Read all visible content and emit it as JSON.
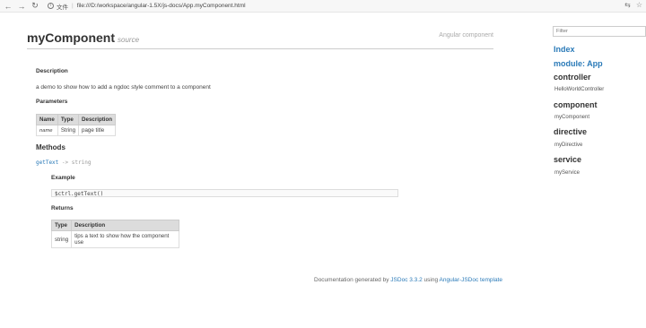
{
  "browser": {
    "back_icon": "←",
    "forward_icon": "→",
    "reload_icon": "↻",
    "info_icon": "i",
    "protocol_label": "文件",
    "separator": "|",
    "url": "file:///D:/workspace/angular-1.5X/js-docs/App.myComponent.html",
    "translate_icon": "⇆",
    "star_icon": "☆"
  },
  "header": {
    "title": "myComponent",
    "source_link": "source",
    "kind": "Angular component"
  },
  "description": {
    "heading": "Description",
    "text": "a demo to show how to add a ngdoc style comment to a component"
  },
  "parameters": {
    "heading": "Parameters",
    "columns": [
      "Name",
      "Type",
      "Description"
    ],
    "rows": [
      {
        "name": "name",
        "type": "String",
        "description": "page title"
      }
    ]
  },
  "methods": {
    "heading": "Methods",
    "items": [
      {
        "name": "getText",
        "arrow": "->",
        "returns_type": "string",
        "example_heading": "Example",
        "example_code": "$ctrl.getText()",
        "returns_heading": "Returns",
        "returns_columns": [
          "Type",
          "Description"
        ],
        "returns_rows": [
          {
            "type": "string",
            "description": "tips a text to show how the component use"
          }
        ]
      }
    ]
  },
  "footer": {
    "prefix": "Documentation generated by",
    "jsdoc_link": "JSDoc 3.3.2",
    "middle": "using",
    "template_link": "Angular-JSDoc template"
  },
  "sidebar": {
    "filter_placeholder": "Filter",
    "index_link": "Index",
    "module_link": "module: App",
    "categories": [
      {
        "label": "controller",
        "items": [
          "HelloWorldController"
        ]
      },
      {
        "label": "component",
        "items": [
          "myComponent"
        ]
      },
      {
        "label": "directive",
        "items": [
          "myDirective"
        ]
      },
      {
        "label": "service",
        "items": [
          "myService"
        ]
      }
    ]
  }
}
